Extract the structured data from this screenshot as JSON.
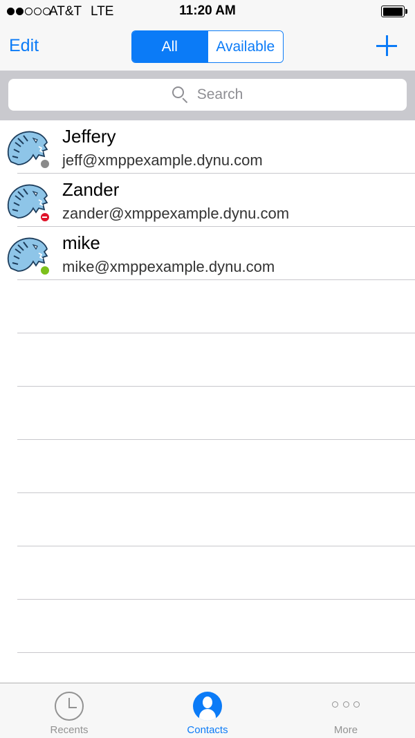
{
  "status_bar": {
    "signal_bars_filled": 2,
    "signal_bars_total": 5,
    "carrier": "AT&T",
    "network": "LTE",
    "time": "11:20 AM",
    "battery_level": 0.9
  },
  "nav_bar": {
    "edit_label": "Edit",
    "segments": [
      {
        "label": "All",
        "selected": true
      },
      {
        "label": "Available",
        "selected": false
      }
    ],
    "add_icon": "plus-icon"
  },
  "search": {
    "placeholder": "Search",
    "icon": "search-icon"
  },
  "contacts": [
    {
      "name": "Jeffery",
      "jid": "jeff@xmppexample.dynu.com",
      "presence": "offline",
      "presence_color": "#8a8a8a"
    },
    {
      "name": "Zander",
      "jid": "zander@xmppexample.dynu.com",
      "presence": "busy",
      "presence_color": "#e0142a"
    },
    {
      "name": "mike",
      "jid": "mike@xmppexample.dynu.com",
      "presence": "available",
      "presence_color": "#7cc01b"
    }
  ],
  "tab_bar": {
    "tabs": [
      {
        "label": "Recents",
        "icon": "clock-icon",
        "active": false
      },
      {
        "label": "Contacts",
        "icon": "person-icon",
        "active": true
      },
      {
        "label": "More",
        "icon": "more-icon",
        "active": false
      }
    ]
  },
  "colors": {
    "accent": "#0b7bf7",
    "inactive": "#929292",
    "avatar_tiger": "#8ec5e8"
  }
}
